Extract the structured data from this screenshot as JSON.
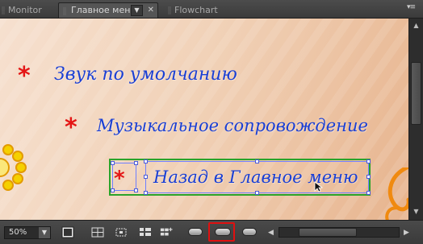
{
  "tabs": [
    {
      "label": "Monitor",
      "active": false
    },
    {
      "label": "Главное меню",
      "active": true
    },
    {
      "label": "Flowchart",
      "active": false
    }
  ],
  "stage": {
    "menu_items": [
      {
        "label": "Звук по умолчанию",
        "bullet": "*"
      },
      {
        "label": "Музыкальное сопровождение",
        "bullet": "*"
      },
      {
        "label": "Назад в Главное меню",
        "bullet": "*"
      }
    ],
    "colors": {
      "text": "#1a3fd4",
      "bullet": "#e41515",
      "selection_group": "#2aa32a",
      "background": "#f1d2b8"
    }
  },
  "toolbar": {
    "zoom_value": "50%",
    "icons": [
      "safe-area-icon",
      "grid-icon",
      "routing-icon",
      "layout-icon",
      "add-layout-icon",
      "button-style-small-icon",
      "button-style-medium-icon",
      "button-style-large-icon"
    ],
    "highlight_color": "#e01010"
  },
  "glyphs": {
    "dropdown": "▼",
    "close": "✕",
    "panel_menu": "▾≡",
    "scroll_up": "▲",
    "scroll_down": "▼",
    "scroll_left": "◀",
    "scroll_right": "▶"
  }
}
